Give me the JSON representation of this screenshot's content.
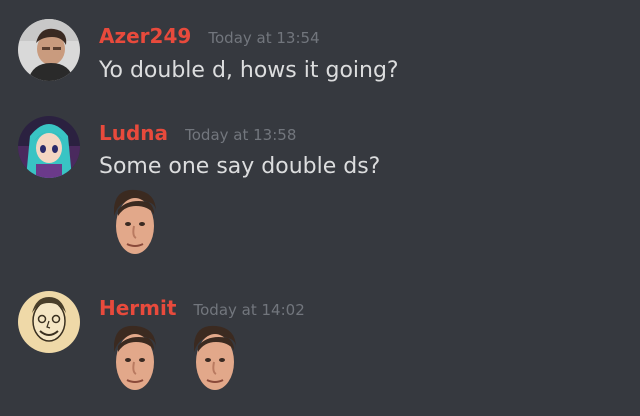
{
  "colors": {
    "background": "#36393f",
    "username": "#e84a3c",
    "timestamp": "#72767d",
    "message_text": "#dcddde"
  },
  "messages": [
    {
      "username": "Azer249",
      "timestamp": "Today at 13:54",
      "text": "Yo double d, hows it going?",
      "avatar_icon": "user-avatar-photo"
    },
    {
      "username": "Ludna",
      "timestamp": "Today at 13:58",
      "text": "Some one say double ds?",
      "avatar_icon": "anime-girl-avatar",
      "emojis": [
        "face-emoji"
      ]
    },
    {
      "username": "Hermit",
      "timestamp": "Today at 14:02",
      "avatar_icon": "sketch-portrait-avatar",
      "emojis": [
        "face-emoji",
        "face-emoji"
      ]
    }
  ]
}
